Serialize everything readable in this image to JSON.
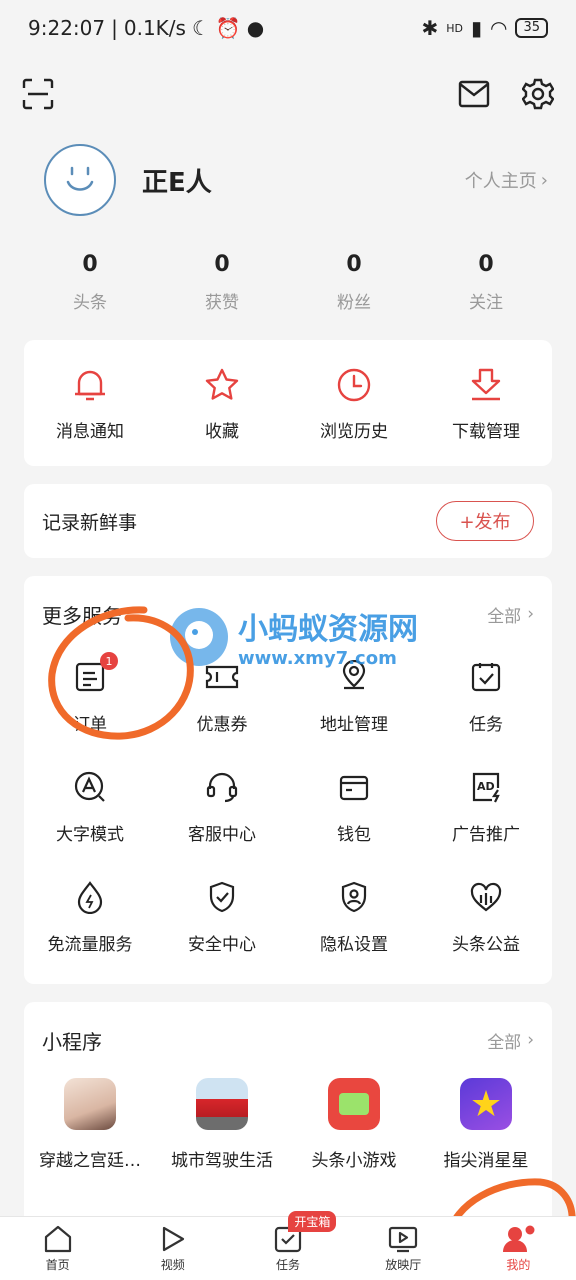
{
  "status": {
    "time": "9:22:07",
    "speed": "0.1K/s",
    "network": "HD",
    "battery": "35"
  },
  "profile": {
    "username": "正E人",
    "homepage_link": "个人主页"
  },
  "stats": [
    {
      "value": "0",
      "label": "头条"
    },
    {
      "value": "0",
      "label": "获赞"
    },
    {
      "value": "0",
      "label": "粉丝"
    },
    {
      "value": "0",
      "label": "关注"
    }
  ],
  "quick_actions": [
    {
      "label": "消息通知",
      "icon": "bell-icon"
    },
    {
      "label": "收藏",
      "icon": "star-icon"
    },
    {
      "label": "浏览历史",
      "icon": "clock-icon"
    },
    {
      "label": "下载管理",
      "icon": "download-icon"
    }
  ],
  "record": {
    "text": "记录新鲜事",
    "publish": "+发布"
  },
  "services": {
    "title": "更多服务",
    "more": "全部",
    "items": [
      {
        "label": "订单",
        "icon": "order-icon",
        "badge": "1"
      },
      {
        "label": "优惠券",
        "icon": "coupon-icon"
      },
      {
        "label": "地址管理",
        "icon": "location-icon"
      },
      {
        "label": "任务",
        "icon": "task-icon"
      },
      {
        "label": "大字模式",
        "icon": "font-size-icon"
      },
      {
        "label": "客服中心",
        "icon": "headset-icon"
      },
      {
        "label": "钱包",
        "icon": "wallet-icon"
      },
      {
        "label": "广告推广",
        "icon": "ad-icon"
      },
      {
        "label": "免流量服务",
        "icon": "data-free-icon"
      },
      {
        "label": "安全中心",
        "icon": "shield-icon"
      },
      {
        "label": "隐私设置",
        "icon": "privacy-icon"
      },
      {
        "label": "头条公益",
        "icon": "charity-icon"
      }
    ]
  },
  "mini_programs": {
    "title": "小程序",
    "more": "全部",
    "items": [
      {
        "label": "穿越之宫廷…",
        "icon": "palace-game-icon"
      },
      {
        "label": "城市驾驶生活",
        "icon": "car-game-icon"
      },
      {
        "label": "头条小游戏",
        "icon": "mini-game-icon"
      },
      {
        "label": "指尖消星星",
        "icon": "star-game-icon"
      }
    ]
  },
  "tabbar": {
    "items": [
      {
        "label": "首页",
        "icon": "home-icon"
      },
      {
        "label": "视频",
        "icon": "play-icon"
      },
      {
        "label": "任务",
        "icon": "task-tab-icon",
        "tag": "开宝箱"
      },
      {
        "label": "放映厅",
        "icon": "tv-icon"
      },
      {
        "label": "我的",
        "icon": "profile-icon",
        "active": true
      }
    ]
  },
  "watermark": {
    "title": "小蚂蚁资源网",
    "url": "www.xmy7.com"
  },
  "colors": {
    "accent": "#e64340",
    "text": "#222222",
    "muted": "#999999",
    "background": "#f4f4f4",
    "annotation": "#f06a2a"
  }
}
